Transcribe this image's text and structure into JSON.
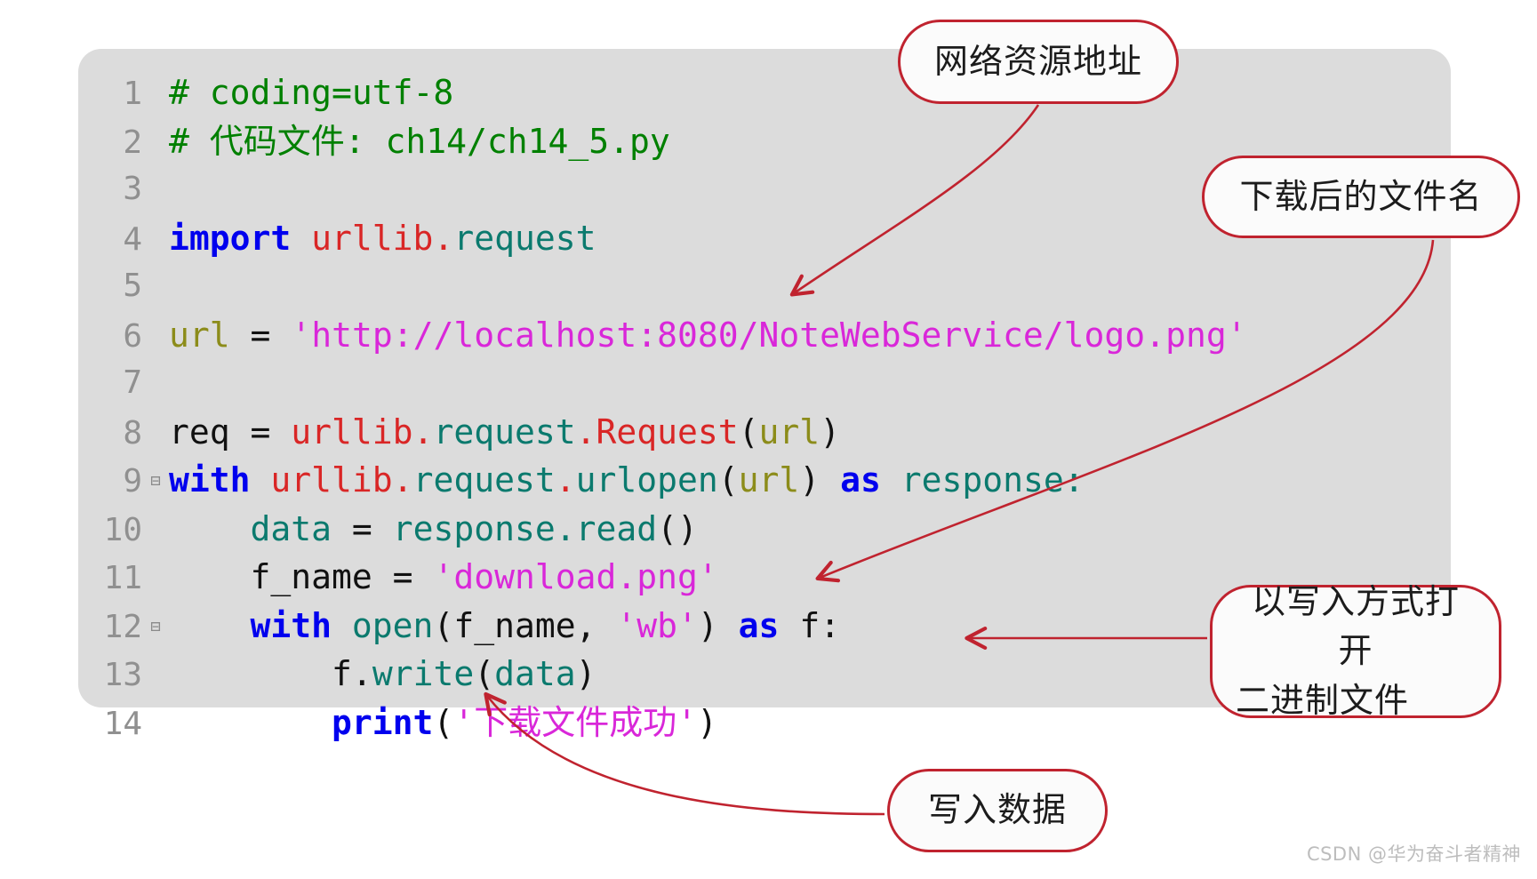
{
  "code_panel": {
    "language": "python",
    "background_color": "#dcdcdc",
    "lines": [
      {
        "number": "1",
        "fold": "",
        "tokens": [
          {
            "text": "# coding=utf-8",
            "kind": "comment"
          }
        ]
      },
      {
        "number": "2",
        "fold": "",
        "tokens": [
          {
            "text": "# 代码文件: ch14/ch14_5.py",
            "kind": "comment"
          }
        ]
      },
      {
        "number": "3",
        "fold": "",
        "tokens": []
      },
      {
        "number": "4",
        "fold": "",
        "tokens": [
          {
            "text": "import",
            "kind": "keyword"
          },
          {
            "text": " ",
            "kind": "plain"
          },
          {
            "text": "urllib",
            "kind": "module"
          },
          {
            "text": ".",
            "kind": "module"
          },
          {
            "text": "request",
            "kind": "function"
          }
        ]
      },
      {
        "number": "5",
        "fold": "",
        "tokens": []
      },
      {
        "number": "6",
        "fold": "",
        "tokens": [
          {
            "text": "url",
            "kind": "variable"
          },
          {
            "text": " ",
            "kind": "plain"
          },
          {
            "text": "=",
            "kind": "plain"
          },
          {
            "text": " ",
            "kind": "plain"
          },
          {
            "text": "'http://localhost:8080/NoteWebService/logo.png'",
            "kind": "string"
          }
        ]
      },
      {
        "number": "7",
        "fold": "",
        "tokens": []
      },
      {
        "number": "8",
        "fold": "",
        "tokens": [
          {
            "text": "req",
            "kind": "plain"
          },
          {
            "text": " = ",
            "kind": "plain"
          },
          {
            "text": "urllib",
            "kind": "module"
          },
          {
            "text": ".",
            "kind": "module"
          },
          {
            "text": "request",
            "kind": "function"
          },
          {
            "text": ".",
            "kind": "module"
          },
          {
            "text": "Request",
            "kind": "module"
          },
          {
            "text": "(",
            "kind": "plain"
          },
          {
            "text": "url",
            "kind": "variable"
          },
          {
            "text": ")",
            "kind": "plain"
          }
        ]
      },
      {
        "number": "9",
        "fold": "⊟",
        "tokens": [
          {
            "text": "with",
            "kind": "keyword"
          },
          {
            "text": " ",
            "kind": "plain"
          },
          {
            "text": "urllib",
            "kind": "module"
          },
          {
            "text": ".",
            "kind": "module"
          },
          {
            "text": "request",
            "kind": "function"
          },
          {
            "text": ".",
            "kind": "module"
          },
          {
            "text": "urlopen",
            "kind": "function"
          },
          {
            "text": "(",
            "kind": "plain"
          },
          {
            "text": "url",
            "kind": "variable"
          },
          {
            "text": ") ",
            "kind": "plain"
          },
          {
            "text": "as",
            "kind": "keyword"
          },
          {
            "text": " ",
            "kind": "plain"
          },
          {
            "text": "response",
            "kind": "function"
          },
          {
            "text": ":",
            "kind": "function"
          }
        ]
      },
      {
        "number": "10",
        "fold": "",
        "tokens": [
          {
            "text": "    ",
            "kind": "plain"
          },
          {
            "text": "data",
            "kind": "function"
          },
          {
            "text": " ",
            "kind": "plain"
          },
          {
            "text": "=",
            "kind": "plain"
          },
          {
            "text": " ",
            "kind": "plain"
          },
          {
            "text": "response",
            "kind": "function"
          },
          {
            "text": ".",
            "kind": "function"
          },
          {
            "text": "read",
            "kind": "function"
          },
          {
            "text": "()",
            "kind": "plain"
          }
        ]
      },
      {
        "number": "11",
        "fold": "",
        "tokens": [
          {
            "text": "    ",
            "kind": "plain"
          },
          {
            "text": "f_name",
            "kind": "plain"
          },
          {
            "text": " = ",
            "kind": "plain"
          },
          {
            "text": "'download.png'",
            "kind": "string"
          }
        ]
      },
      {
        "number": "12",
        "fold": "⊟",
        "tokens": [
          {
            "text": "    ",
            "kind": "plain"
          },
          {
            "text": "with",
            "kind": "keyword"
          },
          {
            "text": " ",
            "kind": "plain"
          },
          {
            "text": "open",
            "kind": "function"
          },
          {
            "text": "(",
            "kind": "plain"
          },
          {
            "text": "f_name",
            "kind": "plain"
          },
          {
            "text": ", ",
            "kind": "plain"
          },
          {
            "text": "'wb'",
            "kind": "string"
          },
          {
            "text": ") ",
            "kind": "plain"
          },
          {
            "text": "as",
            "kind": "keyword"
          },
          {
            "text": " ",
            "kind": "plain"
          },
          {
            "text": "f",
            "kind": "plain"
          },
          {
            "text": ":",
            "kind": "plain"
          }
        ]
      },
      {
        "number": "13",
        "fold": "",
        "tokens": [
          {
            "text": "        ",
            "kind": "plain"
          },
          {
            "text": "f",
            "kind": "plain"
          },
          {
            "text": ".",
            "kind": "plain"
          },
          {
            "text": "write",
            "kind": "function"
          },
          {
            "text": "(",
            "kind": "plain"
          },
          {
            "text": "data",
            "kind": "function"
          },
          {
            "text": ")",
            "kind": "plain"
          }
        ]
      },
      {
        "number": "14",
        "fold": "",
        "tokens": [
          {
            "text": "        ",
            "kind": "plain"
          },
          {
            "text": "print",
            "kind": "keyword"
          },
          {
            "text": "(",
            "kind": "plain"
          },
          {
            "text": "'下载文件成功'",
            "kind": "string"
          },
          {
            "text": ")",
            "kind": "plain"
          }
        ]
      }
    ]
  },
  "callouts": [
    {
      "id": "url",
      "text": "网络资源地址",
      "lines": [
        "网络资源地址"
      ]
    },
    {
      "id": "filename",
      "text": "下载后的文件名",
      "lines": [
        "下载后的文件名"
      ]
    },
    {
      "id": "openmode",
      "text": "以写入方式打开二进制文件",
      "lines": [
        "以写入方式打开",
        "二进制文件"
      ]
    },
    {
      "id": "write",
      "text": "写入数据",
      "lines": [
        "写入数据"
      ]
    }
  ],
  "colors": {
    "panel_background": "#dcdcdc",
    "callout_border": "#c0232f",
    "arrow": "#c0232f",
    "comment": "#008000",
    "keyword": "#0000ee",
    "module": "#d92626",
    "function": "#0b7a6e",
    "string": "#d927d9",
    "variable": "#8c8c1a",
    "line_number": "#909090"
  },
  "watermark": {
    "text": "CSDN @华为奋斗者精神"
  }
}
